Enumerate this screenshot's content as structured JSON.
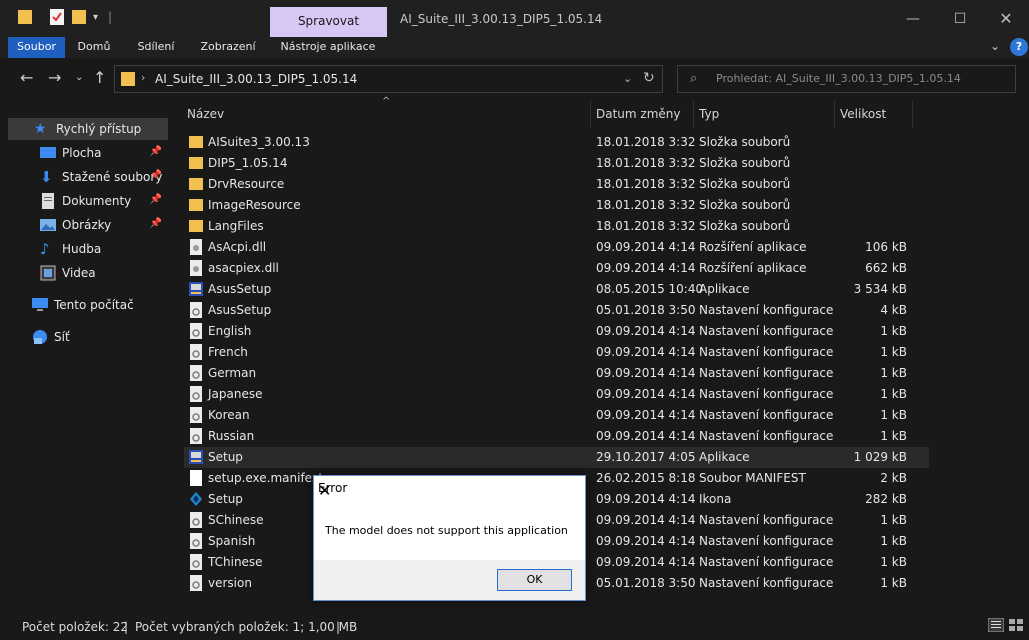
{
  "titlebar": {
    "context_tab": "Spravovat",
    "title": "AI_Suite_III_3.00.13_DIP5_1.05.14"
  },
  "ribbon": {
    "tabs": [
      "Soubor",
      "Domů",
      "Sdílení",
      "Zobrazení",
      "Nástroje aplikace"
    ]
  },
  "address": {
    "path": "AI_Suite_III_3.00.13_DIP5_1.05.14",
    "search_placeholder": "Prohledat: AI_Suite_III_3.00.13_DIP5_1.05.14"
  },
  "sidebar": {
    "items": [
      {
        "label": "Rychlý přístup",
        "icon": "star-icon"
      },
      {
        "label": "Plocha",
        "icon": "desktop-icon"
      },
      {
        "label": "Stažené soubory",
        "icon": "download-icon"
      },
      {
        "label": "Dokumenty",
        "icon": "documents-icon"
      },
      {
        "label": "Obrázky",
        "icon": "pictures-icon"
      },
      {
        "label": "Hudba",
        "icon": "music-icon"
      },
      {
        "label": "Videa",
        "icon": "videos-icon"
      },
      {
        "label": "Tento počítač",
        "icon": "computer-icon"
      },
      {
        "label": "Síť",
        "icon": "network-icon"
      }
    ]
  },
  "columns": {
    "name": "Název",
    "date": "Datum změny",
    "type": "Typ",
    "size": "Velikost"
  },
  "files": [
    {
      "name": "AISuite3_3.00.13",
      "date": "18.01.2018 3:32",
      "type": "Složka souborů",
      "size": "",
      "icon": "folder-icon"
    },
    {
      "name": "DIP5_1.05.14",
      "date": "18.01.2018 3:32",
      "type": "Složka souborů",
      "size": "",
      "icon": "folder-icon"
    },
    {
      "name": "DrvResource",
      "date": "18.01.2018 3:32",
      "type": "Složka souborů",
      "size": "",
      "icon": "folder-icon"
    },
    {
      "name": "ImageResource",
      "date": "18.01.2018 3:32",
      "type": "Složka souborů",
      "size": "",
      "icon": "folder-icon"
    },
    {
      "name": "LangFiles",
      "date": "18.01.2018 3:32",
      "type": "Složka souborů",
      "size": "",
      "icon": "folder-icon"
    },
    {
      "name": "AsAcpi.dll",
      "date": "09.09.2014 4:14",
      "type": "Rozšíření aplikace",
      "size": "106 kB",
      "icon": "dll-icon"
    },
    {
      "name": "asacpiex.dll",
      "date": "09.09.2014 4:14",
      "type": "Rozšíření aplikace",
      "size": "662 kB",
      "icon": "dll-icon"
    },
    {
      "name": "AsusSetup",
      "date": "08.05.2015 10:40",
      "type": "Aplikace",
      "size": "3 534 kB",
      "icon": "setup-icon"
    },
    {
      "name": "AsusSetup",
      "date": "05.01.2018 3:50",
      "type": "Nastavení konfigurace",
      "size": "4 kB",
      "icon": "config-icon"
    },
    {
      "name": "English",
      "date": "09.09.2014 4:14",
      "type": "Nastavení konfigurace",
      "size": "1 kB",
      "icon": "config-icon"
    },
    {
      "name": "French",
      "date": "09.09.2014 4:14",
      "type": "Nastavení konfigurace",
      "size": "1 kB",
      "icon": "config-icon"
    },
    {
      "name": "German",
      "date": "09.09.2014 4:14",
      "type": "Nastavení konfigurace",
      "size": "1 kB",
      "icon": "config-icon"
    },
    {
      "name": "Japanese",
      "date": "09.09.2014 4:14",
      "type": "Nastavení konfigurace",
      "size": "1 kB",
      "icon": "config-icon"
    },
    {
      "name": "Korean",
      "date": "09.09.2014 4:14",
      "type": "Nastavení konfigurace",
      "size": "1 kB",
      "icon": "config-icon"
    },
    {
      "name": "Russian",
      "date": "09.09.2014 4:14",
      "type": "Nastavení konfigurace",
      "size": "1 kB",
      "icon": "config-icon"
    },
    {
      "name": "Setup",
      "date": "29.10.2017 4:05",
      "type": "Aplikace",
      "size": "1 029 kB",
      "icon": "setup-icon",
      "selected": true
    },
    {
      "name": "setup.exe.manifest",
      "date": "26.02.2015 8:18",
      "type": "Soubor MANIFEST",
      "size": "2 kB",
      "icon": "file-icon"
    },
    {
      "name": "Setup",
      "date": "09.09.2014 4:14",
      "type": "Ikona",
      "size": "282 kB",
      "icon": "asus-icon"
    },
    {
      "name": "SChinese",
      "date": "09.09.2014 4:14",
      "type": "Nastavení konfigurace",
      "size": "1 kB",
      "icon": "config-icon"
    },
    {
      "name": "Spanish",
      "date": "09.09.2014 4:14",
      "type": "Nastavení konfigurace",
      "size": "1 kB",
      "icon": "config-icon"
    },
    {
      "name": "TChinese",
      "date": "09.09.2014 4:14",
      "type": "Nastavení konfigurace",
      "size": "1 kB",
      "icon": "config-icon"
    },
    {
      "name": "version",
      "date": "05.01.2018 3:50",
      "type": "Nastavení konfigurace",
      "size": "1 kB",
      "icon": "config-icon"
    }
  ],
  "status": {
    "count": "Počet položek: 22",
    "selected": "Počet vybraných položek: 1; 1,00 MB"
  },
  "dialog": {
    "title": "Error",
    "message": "The model does not support this application",
    "ok_label": "OK"
  },
  "colors": {
    "accent": "#1f5fbf",
    "context_tab": "#d8c6f4",
    "background": "#191919"
  }
}
